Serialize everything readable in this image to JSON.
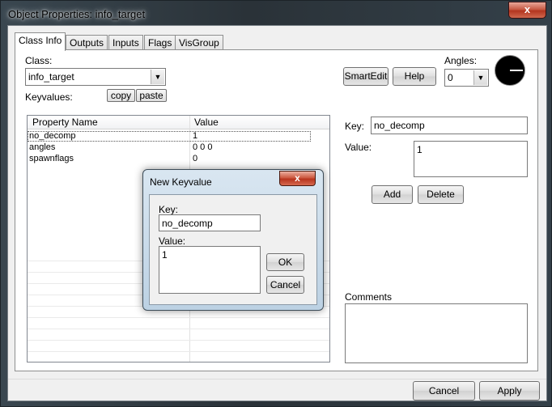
{
  "window": {
    "title": "Object Properties: info_target",
    "close_glyph": "x"
  },
  "tabs": [
    {
      "label": "Class Info",
      "active": true
    },
    {
      "label": "Outputs"
    },
    {
      "label": "Inputs"
    },
    {
      "label": "Flags"
    },
    {
      "label": "VisGroup"
    }
  ],
  "classinfo": {
    "class_label": "Class:",
    "class_value": "info_target",
    "keyvalues_label": "Keyvalues:",
    "copy_label": "copy",
    "paste_label": "paste",
    "smartedit_label": "SmartEdit",
    "help_label": "Help",
    "angles_label": "Angles:",
    "angles_value": "0"
  },
  "keyvalues_table": {
    "headers": [
      "Property Name",
      "Value"
    ],
    "rows": [
      {
        "name": "no_decomp",
        "value": "1"
      },
      {
        "name": "angles",
        "value": "0 0 0"
      },
      {
        "name": "spawnflags",
        "value": "0"
      }
    ]
  },
  "editor": {
    "key_label": "Key:",
    "key_value": "no_decomp",
    "value_label": "Value:",
    "value_value": "1",
    "add_label": "Add",
    "delete_label": "Delete",
    "comments_label": "Comments"
  },
  "footer": {
    "cancel_label": "Cancel",
    "apply_label": "Apply"
  },
  "dialog": {
    "title": "New Keyvalue",
    "close_glyph": "x",
    "key_label": "Key:",
    "key_value": "no_decomp",
    "value_label": "Value:",
    "value_value": "1",
    "ok_label": "OK",
    "cancel_label": "Cancel"
  },
  "icons": {
    "dropdown": "chevron-down-icon",
    "compass": "angle-compass-icon",
    "close": "close-icon"
  }
}
